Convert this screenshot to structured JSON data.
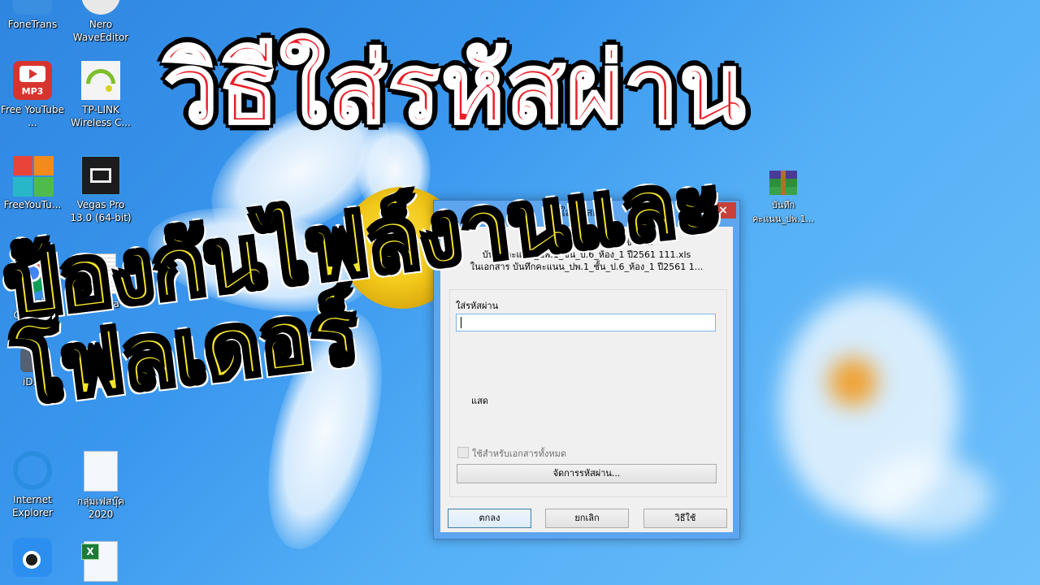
{
  "overlay": {
    "title": "วิธีใส่รหัสผ่าน",
    "subtitle": "ป้องกันไฟล์งานและโฟลเดอร์",
    "title_color": "#e8202a",
    "subtitle_color": "#f6e52a"
  },
  "desktop": {
    "icons": [
      {
        "label": "FoneTrans",
        "icon": "fonetrans-icon"
      },
      {
        "label": "Nero WaveEditor",
        "icon": "nero-waveeditor-icon"
      },
      {
        "label": "Free YouTube ...",
        "icon": "free-youtube-mp3-icon",
        "badge": "MP3"
      },
      {
        "label": "TP-LINK Wireless C...",
        "icon": "tplink-wireless-icon"
      },
      {
        "label": "FreeYouTu...",
        "icon": "freeyoutube-icon"
      },
      {
        "label": "Vegas Pro 13.0 (64-bit)",
        "icon": "vegas-pro-icon"
      },
      {
        "label": "Google Chrome",
        "icon": "chrome-icon"
      },
      {
        "label": "ransara",
        "icon": "text-document-icon"
      },
      {
        "label": "iD...",
        "icon": "id-app-icon"
      },
      {
        "label": "",
        "icon": "excel-file-icon"
      },
      {
        "label": "Internet Explorer",
        "icon": "internet-explorer-icon"
      },
      {
        "label": "กลุ่มเฟสบุ๊ค 2020",
        "icon": "excel-file-icon"
      },
      {
        "label": "",
        "icon": "itools-icon"
      },
      {
        "label": "",
        "icon": "excel-file-icon"
      },
      {
        "label": "บันทึก คะแนน_ปพ.1...",
        "icon": "winrar-archive-icon"
      }
    ]
  },
  "dialog": {
    "title": "ใส่รหัสผ่าน",
    "close_label": "×",
    "message_line1": "ใส่รหัสผ่านสำหรับไฟล์ที่ถูกเข้ารหัส",
    "message_line2": "บันทึกคะแนน_ปพ.1_ชั้น_ป.6_ห้อง_1 ปี2561 111.xls",
    "message_line3": "ในเอกสาร บันทึกคะแนน_ปพ.1_ชั้น_ป.6_ห้อง_1 ปี2561 1...",
    "password_label": "ใส่รหัสผ่าน",
    "password_value": "",
    "show_label": "แสด",
    "apply_all_label": "ใช้สำหรับเอกสารทั้งหมด",
    "apply_all_checked": false,
    "manage_button": "จัดการรหัสผ่าน...",
    "ok_button": "ตกลง",
    "cancel_button": "ยกเลิก",
    "help_button": "วิธีใช้"
  }
}
